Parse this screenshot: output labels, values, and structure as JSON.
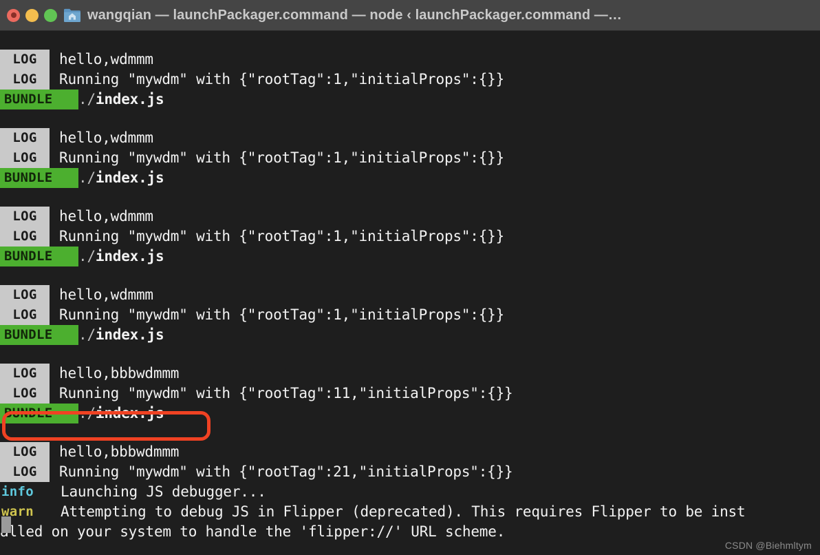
{
  "window": {
    "title": "wangqian — launchPackager.command — node ‹ launchPackager.command —…",
    "titlebar_color": "#454545",
    "background_color": "#1e1e1e",
    "traffic_lights": {
      "close": "#ec6a5f",
      "minimize": "#f3bd4e",
      "maximize": "#61c554"
    },
    "folder_icon_name": "home-folder-icon"
  },
  "colors": {
    "log_badge_bg": "#c9c9c9",
    "log_badge_fg": "#1b1b1b",
    "bundle_badge_bg": "#4caf2f",
    "bundle_badge_fg": "#12260a",
    "info_fg": "#5fc9dd",
    "warn_fg": "#cfc44f",
    "text_fg": "#f2f2f2",
    "annotation": "#f04223",
    "cursor": "#9b9b9b"
  },
  "terminal": {
    "blocks": [
      {
        "lines": [
          {
            "badge": "LOG",
            "type": "log",
            "text": "hello,wdmmm"
          },
          {
            "badge": "LOG",
            "type": "log",
            "text": "Running \"mywdm\" with {\"rootTag\":1,\"initialProps\":{}}"
          },
          {
            "badge": "BUNDLE",
            "type": "bundle",
            "prefix": "./",
            "text": "index.js"
          }
        ]
      },
      {
        "lines": [
          {
            "badge": "LOG",
            "type": "log",
            "text": "hello,wdmmm"
          },
          {
            "badge": "LOG",
            "type": "log",
            "text": "Running \"mywdm\" with {\"rootTag\":1,\"initialProps\":{}}"
          },
          {
            "badge": "BUNDLE",
            "type": "bundle",
            "prefix": "./",
            "text": "index.js"
          }
        ]
      },
      {
        "lines": [
          {
            "badge": "LOG",
            "type": "log",
            "text": "hello,wdmmm"
          },
          {
            "badge": "LOG",
            "type": "log",
            "text": "Running \"mywdm\" with {\"rootTag\":1,\"initialProps\":{}}"
          },
          {
            "badge": "BUNDLE",
            "type": "bundle",
            "prefix": "./",
            "text": "index.js"
          }
        ]
      },
      {
        "lines": [
          {
            "badge": "LOG",
            "type": "log",
            "text": "hello,wdmmm"
          },
          {
            "badge": "LOG",
            "type": "log",
            "text": "Running \"mywdm\" with {\"rootTag\":1,\"initialProps\":{}}"
          },
          {
            "badge": "BUNDLE",
            "type": "bundle",
            "prefix": "./",
            "text": "index.js"
          }
        ]
      },
      {
        "lines": [
          {
            "badge": "LOG",
            "type": "log",
            "text": "hello,bbbwdmmm"
          },
          {
            "badge": "LOG",
            "type": "log",
            "text": "Running \"mywdm\" with {\"rootTag\":11,\"initialProps\":{}}"
          },
          {
            "badge": "BUNDLE",
            "type": "bundle",
            "prefix": "./",
            "text": "index.js"
          }
        ]
      },
      {
        "lines": [
          {
            "badge": "LOG",
            "type": "log",
            "text": "hello,bbbwdmmm",
            "highlighted": true
          },
          {
            "badge": "LOG",
            "type": "log",
            "text": "Running \"mywdm\" with {\"rootTag\":21,\"initialProps\":{}}"
          },
          {
            "badge": "info",
            "type": "info",
            "text": "Launching JS debugger..."
          },
          {
            "badge": "warn",
            "type": "warn",
            "text": "Attempting to debug JS in Flipper (deprecated). This requires Flipper to be inst"
          },
          {
            "badge": "",
            "type": "continuation",
            "text": "alled on your system to handle the 'flipper://' URL scheme."
          }
        ]
      }
    ]
  },
  "annotation": {
    "label": "red-highlight-box",
    "target_text": "LOG hello,bbbwdmmm"
  },
  "watermark": {
    "text": "CSDN @Biehmltym"
  }
}
